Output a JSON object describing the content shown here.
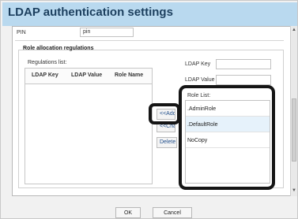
{
  "dialog": {
    "title": "LDAP authentication settings"
  },
  "pin": {
    "label": "PIN",
    "value": "pin"
  },
  "role_allocation": {
    "section_title": "Role allocation regulations",
    "regulations_label": "Regulations list:",
    "columns": [
      "LDAP Key",
      "LDAP Value",
      "Role Name"
    ],
    "buttons": {
      "add": "<<Add",
      "change": "<<Cha",
      "delete": "Delete"
    },
    "ldap_key_label": "LDAP Key",
    "ldap_key_value": "",
    "ldap_value_label": "LDAP Value",
    "ldap_value_value": "",
    "role_list_label": "Role List:",
    "roles": [
      ".AdminRole",
      ".DefaultRole",
      "NoCopy"
    ],
    "selected_role": ".DefaultRole"
  },
  "footer": {
    "ok": "OK",
    "cancel": "Cancel"
  }
}
